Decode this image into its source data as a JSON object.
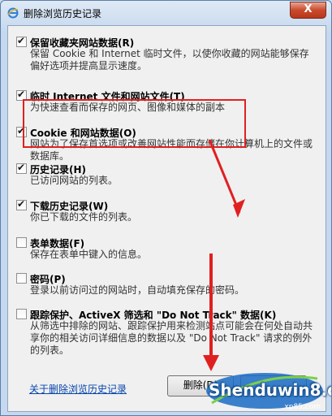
{
  "window": {
    "title": "删除浏览历史记录",
    "close_label": "X"
  },
  "items": [
    {
      "label": "保留收藏夹网站数据(R)",
      "description": "保留 Cookie 和 Internet 临时文件，以使你收藏的网站能够保存偏好选项并提高显示速度。",
      "checked": true
    },
    {
      "label": "临时 Internet 文件和网站文件(T)",
      "description": "为快速查看而保存的网页、图像和媒体的副本",
      "checked": true
    },
    {
      "label": "Cookie 和网站数据(O)",
      "description": "网站为了保存首选项或改善网站性能而存储在你计算机上的文件或数据库。",
      "checked": true
    },
    {
      "label": "历史记录(H)",
      "description": "已访问网站的列表。",
      "checked": true
    },
    {
      "label": "下载历史记录(W)",
      "description": "你已下载的文件的列表。",
      "checked": true
    },
    {
      "label": "表单数据(F)",
      "description": "保存在表单中键入的信息。",
      "checked": false
    },
    {
      "label": "密码(P)",
      "description": "登录以前访问过的网站时，自动填充保存的密码。",
      "checked": false
    },
    {
      "label": "跟踪保护、ActiveX 筛选和 \"Do Not Track\" 数据(K)",
      "description": "从筛选中排除的网站、跟踪保护用来检测站点可能会在何处自动共享你的相关访问详细信息的数据以及 \"Do Not Track\" 请求的例外的列表。",
      "checked": false
    }
  ],
  "footer": {
    "link": "关于删除浏览历史记录",
    "delete_button": "删除(D)"
  },
  "watermark": {
    "text": "Shenduwin8.com",
    "small": "xp85.com"
  },
  "colors": {
    "highlight": "#e02020",
    "arrow": "#e02020"
  }
}
